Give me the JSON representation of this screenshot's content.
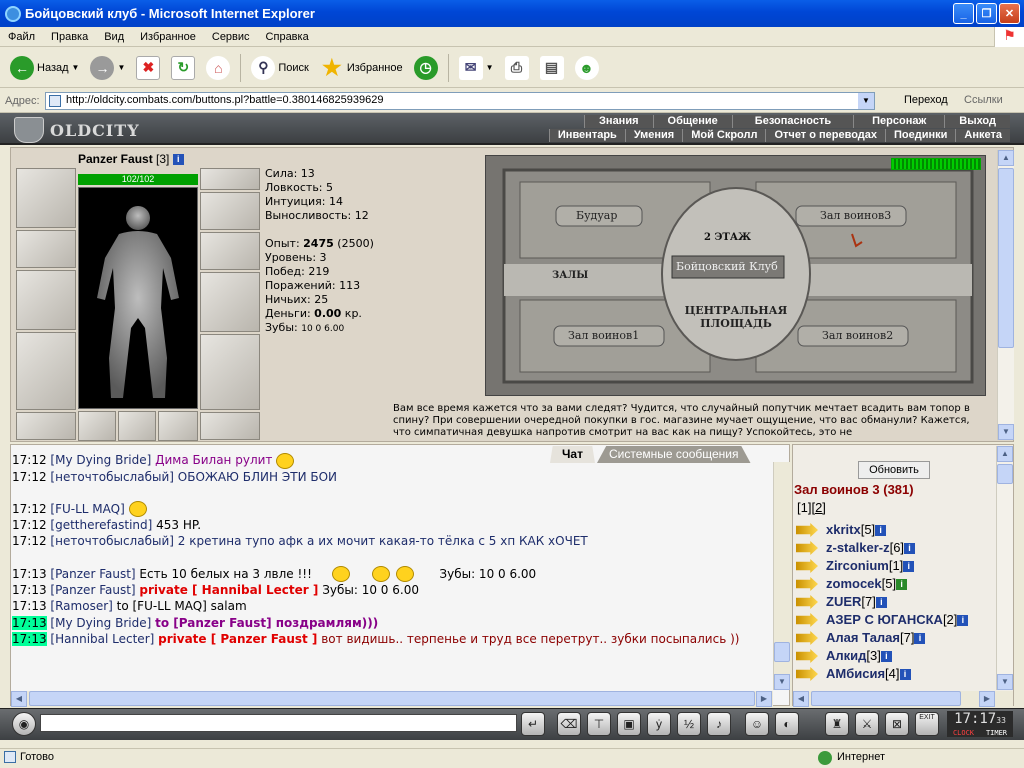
{
  "window": {
    "title": "Бойцовский клуб - Microsoft Internet Explorer"
  },
  "menu": [
    "Файл",
    "Правка",
    "Вид",
    "Избранное",
    "Сервис",
    "Справка"
  ],
  "toolbar": {
    "back": "Назад",
    "search": "Поиск",
    "favorites": "Избранное"
  },
  "address": {
    "label": "Адрес:",
    "url": "http://oldcity.combats.com/buttons.pl?battle=0.380146825939629",
    "go": "Переход",
    "links": "Ссылки"
  },
  "game": {
    "logo": "OLDCITY",
    "nav_top": [
      "Знания",
      "Общение",
      "Безопасность",
      "Персонаж",
      "Выход"
    ],
    "nav_bottom": [
      "Инвентарь",
      "Умения",
      "Мой Скролл",
      "Отчет о переводах",
      "Поединки",
      "Анкета"
    ]
  },
  "player": {
    "name": "Panzer Faust",
    "level": "[3]",
    "hp": "102/102",
    "hp_fraction": 1.0
  },
  "stats": {
    "strength": "Сила: 13",
    "agility": "Ловкость: 5",
    "intuition": "Интуиция: 14",
    "endurance": "Выносливость: 12",
    "exp_label": "Опыт: ",
    "exp_value": "2475",
    "exp_next": " (2500)",
    "level": "Уровень: 3",
    "wins": "Побед: 219",
    "losses": "Поражений: 113",
    "draws": "Ничьих: 25",
    "money_label": "Деньги: ",
    "money_value": "0.00",
    "money_unit": " кр.",
    "teeth_label": "Зубы: ",
    "teeth_values": "10  0  6.00"
  },
  "map": {
    "labels": {
      "boudoir": "Будуар",
      "hall3": "Зал воинов3",
      "floor": "2 ЭТАЖ",
      "club": "Бойцовский Клуб",
      "halls": "ЗАЛЫ",
      "square": "ЦЕНТРАЛЬНАЯ\nПЛОЩАДЬ",
      "hall1": "Зал воинов1",
      "hall2": "Зал воинов2"
    }
  },
  "tip": "Вам все время кажется что за вами следят? Чудится, что случайный попутчик мечтает всадить вам топор в спину? При совершении очередной покупки в гос. магазине мучает ощущение, что вас обманули? Кажется, что симпатичная девушка напротив смотрит на вас как на пищу? Успокойтесь, это не",
  "chat": {
    "tabs": [
      "Чат",
      "Системные сообщения"
    ],
    "lines": [
      {
        "time": "17:12",
        "nick": "[My Dying Bride]",
        "text": "Дима Билан рулит"
      },
      {
        "time": "17:12",
        "nick": "[неточтобыслабый]",
        "text": "ОБОЖАЮ БЛИН ЭТИ БОИ"
      },
      {
        "time": "17:12",
        "nick": "[FU-LL MAQ]",
        "text": ""
      },
      {
        "time": "17:12",
        "nick": "[gettherefastind]",
        "text": "453 HP."
      },
      {
        "time": "17:12",
        "nick": "[неточтобыслабый]",
        "text": "2 кретина тупо афк а их мочит какая-то тёлка с 5 хп КАК хОЧЕТ"
      },
      {
        "time": "17:13",
        "nick": "[Panzer Faust]",
        "text": "Есть 10 белых на 3 лвле !!!",
        "extra": "Зубы:  10  0  6.00"
      },
      {
        "time": "17:13",
        "nick": "[Panzer Faust]",
        "private": "private [ Hannibal Lecter ]",
        "text": "Зубы:  10  0  6.00"
      },
      {
        "time": "17:13",
        "nick": "[Ramoser]",
        "text": "to [FU-LL MAQ] salam"
      },
      {
        "time": "17:13",
        "nick": "[My Dying Bride]",
        "text": "to [Panzer Faust] поздрамлям)))"
      },
      {
        "time": "17:13",
        "nick": "[Hannibal Lecter]",
        "private": "private [ Panzer Faust ]",
        "text": "вот видишь.. терпенье и труд все перетрут.. зубки посыпались ))"
      }
    ]
  },
  "room": {
    "refresh": "Обновить",
    "title": "Зал воинов 3 (381)",
    "page1": "[1]",
    "page2": "[2]",
    "users": [
      {
        "name": "xkritx",
        "level": "[5]"
      },
      {
        "name": "z-stalker-z",
        "level": "[6]"
      },
      {
        "name": "Zirconium",
        "level": "[1]"
      },
      {
        "name": "zomocek",
        "level": "[5]"
      },
      {
        "name": "ZUER",
        "level": "[7]"
      },
      {
        "name": "АЗЕР С ЮГАНСКА",
        "level": "[2]"
      },
      {
        "name": "Алая Талая",
        "level": "[7]"
      },
      {
        "name": "Алкид",
        "level": "[3]"
      },
      {
        "name": "АМбисия",
        "level": "[4]"
      }
    ]
  },
  "clock": {
    "time": "17:17",
    "seconds": "33",
    "clock_label": "CLOCK",
    "timer_label": "TIMER"
  },
  "status": {
    "left": "Готово",
    "right": "Интернет"
  }
}
